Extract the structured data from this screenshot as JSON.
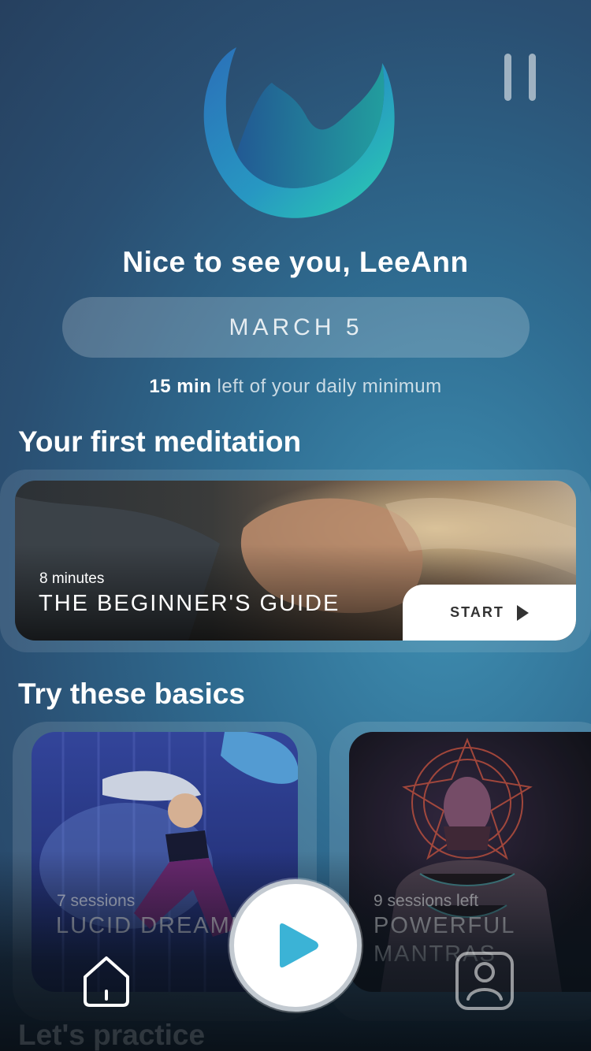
{
  "header": {
    "logo_icon": "crescent-moon-logo",
    "pause_icon": "pause-icon"
  },
  "greeting": "Nice to see you, LeeAnn",
  "date": "MARCH 5",
  "daily_minimum": {
    "minutes": "15 min",
    "text": "left of your daily minimum"
  },
  "first_meditation": {
    "section_title": "Your first meditation",
    "duration": "8 minutes",
    "title": "THE BEGINNER'S GUIDE",
    "start_label": "START"
  },
  "basics": {
    "section_title": "Try these basics",
    "cards": [
      {
        "sessions": "7 sessions",
        "title": "LUCID DREAMING"
      },
      {
        "sessions": "9 sessions left",
        "title": "POWERFUL MANTRAS"
      }
    ]
  },
  "practice": {
    "section_title": "Let's practice"
  },
  "nav": {
    "home_icon": "home-icon",
    "play_icon": "play-icon",
    "profile_icon": "profile-icon"
  },
  "colors": {
    "accent_play": "#3bb3d6",
    "logo_teal": "#26c2b0",
    "logo_blue": "#2c84c4"
  }
}
